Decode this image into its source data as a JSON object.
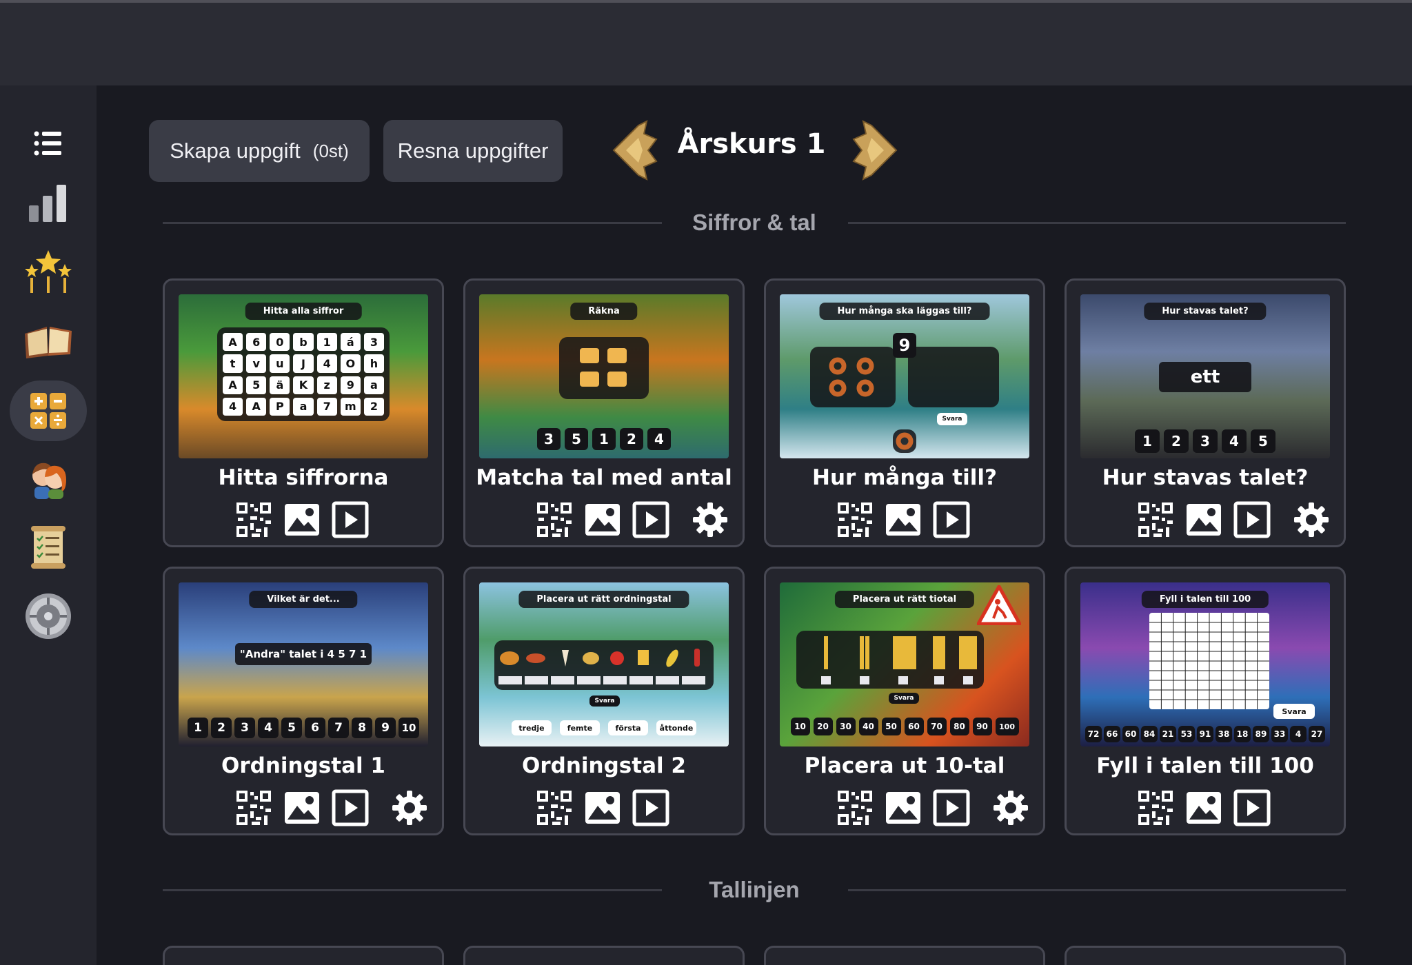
{
  "header": {
    "create_label": "Skapa uppgift",
    "create_count": "(0st)",
    "reset_label": "Resna uppgifter",
    "grade_title": "Årskurs 1"
  },
  "sidebar": {
    "items": [
      {
        "icon": "menu-icon"
      },
      {
        "icon": "bar-chart-icon"
      },
      {
        "icon": "stars-arrows-icon"
      },
      {
        "icon": "open-book-icon"
      },
      {
        "icon": "math-operations-icon",
        "active": true
      },
      {
        "icon": "kids-icon"
      },
      {
        "icon": "scroll-list-icon"
      },
      {
        "icon": "vault-icon"
      }
    ]
  },
  "sections": [
    {
      "title": "Siffror & tal",
      "cards": [
        {
          "title": "Hitta siffrorna",
          "thumb_label": "Hitta alla siffror",
          "rows": [
            [
              "A",
              "6",
              "0",
              "b",
              "1",
              "á",
              "3"
            ],
            [
              "t",
              "v",
              "u",
              "J",
              "4",
              "O",
              "h"
            ],
            [
              "A",
              "5",
              "ä",
              "K",
              "z",
              "9",
              "a"
            ],
            [
              "4",
              "A",
              "P",
              "a",
              "7",
              "m",
              "2"
            ]
          ],
          "settings": false
        },
        {
          "title": "Matcha tal med antal",
          "thumb_label": "Räkna",
          "tiles": [
            "3",
            "5",
            "1",
            "2",
            "4"
          ],
          "settings": true
        },
        {
          "title": "Hur många till?",
          "thumb_label": "Hur många ska läggas till?",
          "badge": "9",
          "submit": "Svara",
          "settings": false
        },
        {
          "title": "Hur stavas talet?",
          "thumb_label": "Hur stavas talet?",
          "word": "ett",
          "tiles": [
            "1",
            "2",
            "3",
            "4",
            "5"
          ],
          "settings": true
        },
        {
          "title": "Ordningstal 1",
          "thumb_label": "Vilket är det...",
          "question": "\"Andra\" talet i 4 5 7 1",
          "tiles": [
            "1",
            "2",
            "3",
            "4",
            "5",
            "6",
            "7",
            "8",
            "9",
            "10"
          ],
          "settings": true
        },
        {
          "title": "Ordningstal 2",
          "thumb_label": "Placera ut rätt ordningstal",
          "submit": "Svara",
          "words": [
            "tredje",
            "femte",
            "första",
            "åttonde"
          ],
          "settings": false
        },
        {
          "title": "Placera ut 10-tal",
          "thumb_label": "Placera ut rätt tiotal",
          "submit": "Svara",
          "tiles": [
            "10",
            "20",
            "30",
            "40",
            "50",
            "60",
            "70",
            "80",
            "90",
            "100"
          ],
          "settings": true
        },
        {
          "title": "Fyll i talen till 100",
          "thumb_label": "Fyll i talen till 100",
          "submit": "Svara",
          "tiles": [
            "72",
            "66",
            "60",
            "84",
            "21",
            "53",
            "91",
            "38",
            "18",
            "89",
            "33",
            "4",
            "27"
          ],
          "settings": false
        }
      ]
    },
    {
      "title": "Tallinjen",
      "cards": []
    }
  ],
  "colors": {
    "background": "#191a21",
    "card_border": "#474853",
    "button_bg": "#3a3c46",
    "arrow_gold": "#c9a15a"
  }
}
